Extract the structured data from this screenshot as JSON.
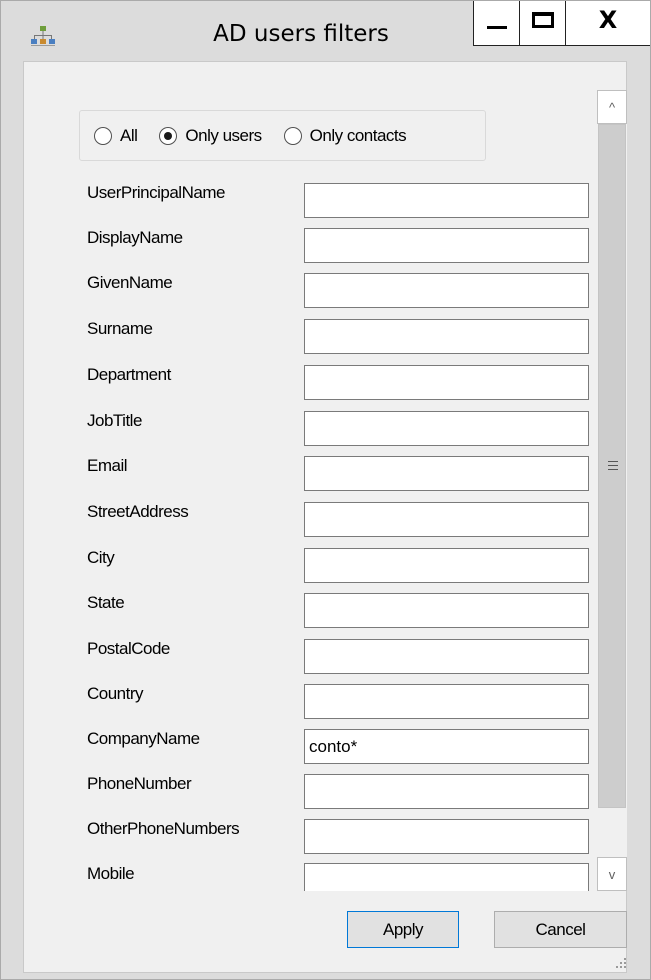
{
  "window": {
    "title": "AD users filters",
    "app_icon": "network-tree-icon",
    "caption_buttons": [
      "minimize-icon",
      "maximize-icon",
      "close-icon"
    ],
    "close_glyph": "X"
  },
  "filter_type": {
    "options": [
      "All",
      "Only users",
      "Only contacts"
    ],
    "selected": "Only users"
  },
  "fields": [
    {
      "label": "UserPrincipalName",
      "value": ""
    },
    {
      "label": "DisplayName",
      "value": ""
    },
    {
      "label": "GivenName",
      "value": ""
    },
    {
      "label": "Surname",
      "value": ""
    },
    {
      "label": "Department",
      "value": ""
    },
    {
      "label": "JobTitle",
      "value": ""
    },
    {
      "label": "Email",
      "value": ""
    },
    {
      "label": "StreetAddress",
      "value": ""
    },
    {
      "label": "City",
      "value": ""
    },
    {
      "label": "State",
      "value": ""
    },
    {
      "label": "PostalCode",
      "value": ""
    },
    {
      "label": "Country",
      "value": ""
    },
    {
      "label": "CompanyName",
      "value": "conto*"
    },
    {
      "label": "PhoneNumber",
      "value": ""
    },
    {
      "label": "OtherPhoneNumbers",
      "value": ""
    },
    {
      "label": "Mobile",
      "value": ""
    }
  ],
  "scrollbar": {
    "up_icon": "chevron-up-icon",
    "down_icon": "chevron-down-icon",
    "up_glyph": "^",
    "down_glyph": "v"
  },
  "buttons": {
    "apply": "Apply",
    "cancel": "Cancel"
  },
  "colors": {
    "window_bg": "#dcdcdc",
    "client_bg": "#f0f0f0",
    "default_button_border": "#0078d7"
  }
}
